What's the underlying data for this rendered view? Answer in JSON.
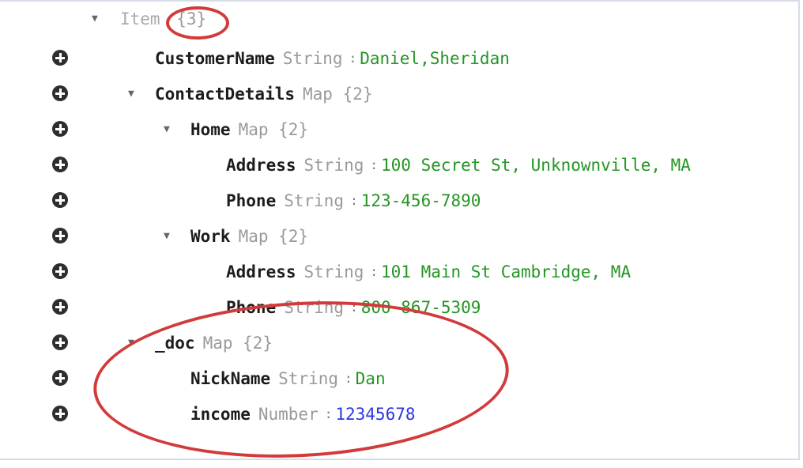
{
  "tree": {
    "root": {
      "key": "Item",
      "type": "{3}"
    },
    "rows": [
      {
        "key": "CustomerName",
        "type": "String",
        "value": "Daniel,Sheridan",
        "value_kind": "string"
      },
      {
        "key": "ContactDetails",
        "type": "Map {2}",
        "value": null,
        "value_kind": "map"
      },
      {
        "key": "Home",
        "type": "Map {2}",
        "value": null,
        "value_kind": "map"
      },
      {
        "key": "Address",
        "type": "String",
        "value": "100 Secret St, Unknownville, MA",
        "value_kind": "string"
      },
      {
        "key": "Phone",
        "type": "String",
        "value": "123-456-7890",
        "value_kind": "string"
      },
      {
        "key": "Work",
        "type": "Map {2}",
        "value": null,
        "value_kind": "map"
      },
      {
        "key": "Address",
        "type": "String",
        "value": "101 Main St Cambridge, MA",
        "value_kind": "string"
      },
      {
        "key": "Phone",
        "type": "String",
        "value": "800-867-5309",
        "value_kind": "string"
      },
      {
        "key": "_doc",
        "type": "Map {2}",
        "value": null,
        "value_kind": "map"
      },
      {
        "key": "NickName",
        "type": "String",
        "value": "Dan",
        "value_kind": "string"
      },
      {
        "key": "income",
        "type": "Number",
        "value": "12345678",
        "value_kind": "number"
      }
    ]
  },
  "icons": {
    "add": "plus-circle-icon",
    "expand": "caret-down-icon"
  },
  "colors": {
    "string_value": "#249524",
    "number_value": "#2a36e6",
    "annotation": "#d23b3b"
  }
}
